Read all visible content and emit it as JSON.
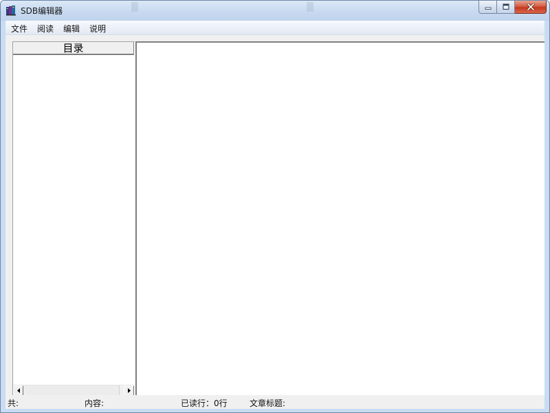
{
  "window": {
    "title": "SDB编辑器",
    "icon": "app-book-icon",
    "controls": {
      "minimize_icon": "minimize-icon",
      "maximize_icon": "maximize-icon",
      "close_icon": "close-icon"
    },
    "accent_color": "#c7381d"
  },
  "menu": {
    "items": [
      {
        "label": "文件"
      },
      {
        "label": "阅读"
      },
      {
        "label": "编辑"
      },
      {
        "label": "说明"
      }
    ]
  },
  "catalog": {
    "header": "目录",
    "items": []
  },
  "status": {
    "total_label": "共:",
    "total_value": "",
    "content_label": "内容:",
    "content_value": "",
    "read_lines": "已读行：0行",
    "article_title_label": "文章标题:",
    "article_title_value": ""
  }
}
